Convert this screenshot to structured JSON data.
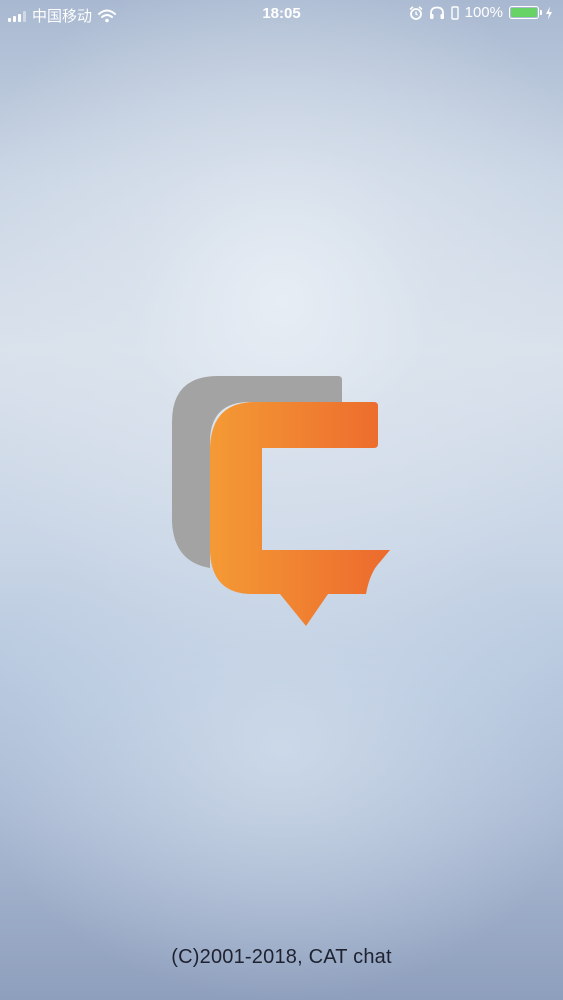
{
  "status_bar": {
    "carrier": "中国移动",
    "time": "18:05",
    "battery_percent": "100%",
    "battery_level": 1.0,
    "icons": [
      "signal-icon",
      "wifi-icon",
      "alarm-icon",
      "headphones-icon",
      "battery-icon",
      "charging-icon"
    ]
  },
  "splash": {
    "copyright": "(C)2001-2018, CAT chat",
    "colors": {
      "logo_gray": "#a3a3a3",
      "logo_orange_start": "#f49a35",
      "logo_orange_end": "#ec6a2d"
    }
  }
}
